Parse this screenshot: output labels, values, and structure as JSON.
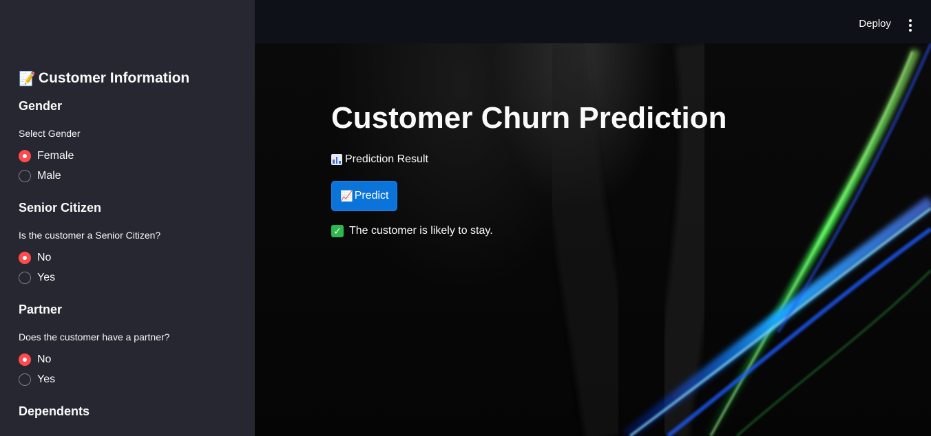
{
  "sidebar": {
    "title_icon": "memo-icon",
    "title": "Customer Information",
    "sections": [
      {
        "heading": "Gender",
        "question": "Select Gender",
        "options": [
          "Female",
          "Male"
        ],
        "selected": "Female"
      },
      {
        "heading": "Senior Citizen",
        "question": "Is the customer a Senior Citizen?",
        "options": [
          "No",
          "Yes"
        ],
        "selected": "No"
      },
      {
        "heading": "Partner",
        "question": "Does the customer have a partner?",
        "options": [
          "No",
          "Yes"
        ],
        "selected": "No"
      },
      {
        "heading": "Dependents"
      }
    ]
  },
  "header": {
    "deploy_label": "Deploy",
    "menu_icon": "more-vertical-icon"
  },
  "main": {
    "title": "Customer Churn Prediction",
    "result_label": "Prediction Result",
    "result_label_icon": "bar-chart-icon",
    "predict_label": "Predict",
    "predict_icon": "chart-increasing-icon",
    "result_message": "The customer is likely to stay.",
    "result_icon": "check-mark-icon"
  },
  "colors": {
    "sidebar_bg": "#262730",
    "header_bg": "#0e1117",
    "radio_selected": "#ff4b4b",
    "button_bg": "#0a74da",
    "success_icon": "#2db84d"
  }
}
